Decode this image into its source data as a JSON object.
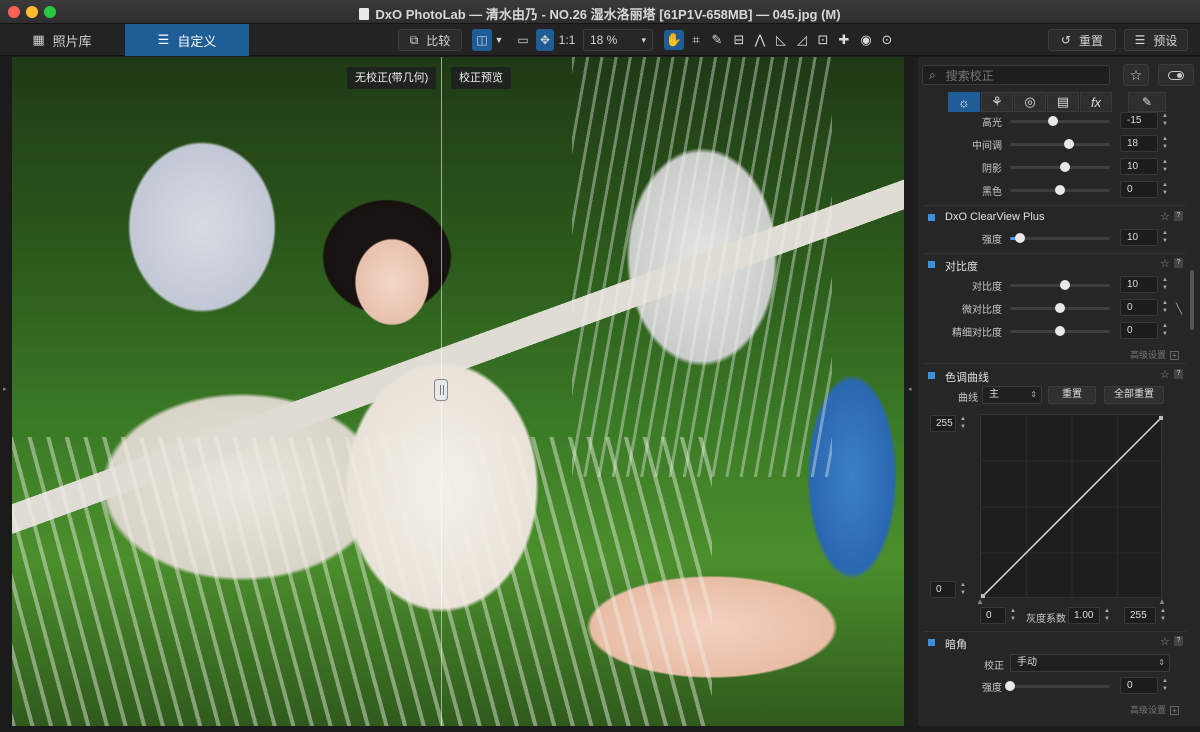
{
  "window": {
    "title": "DxO PhotoLab — 清水由乃 - NO.26 湿水洛丽塔 [61P1V-658MB] — 045.jpg (M)"
  },
  "toolbar": {
    "tab_library": "照片库",
    "tab_customize": "自定义",
    "compare_label": "比较",
    "ratio_label": "1:1",
    "zoom_value": "18 %",
    "reset_label": "重置",
    "preset_label": "预设"
  },
  "viewer": {
    "label_before": "无校正(带几何)",
    "label_after": "校正预览"
  },
  "panel": {
    "search_placeholder": "搜索校正",
    "tone": {
      "rows": [
        {
          "label": "高光",
          "value": "-15",
          "fraction": 0.43
        },
        {
          "label": "中间调",
          "value": "18",
          "fraction": 0.59
        },
        {
          "label": "阴影",
          "value": "10",
          "fraction": 0.55
        },
        {
          "label": "黑色",
          "value": "0",
          "fraction": 0.5
        }
      ]
    },
    "clearview": {
      "title": "DxO ClearView Plus",
      "strength_label": "强度",
      "strength_value": "10",
      "strength_fraction": 0.1
    },
    "contrast": {
      "title": "对比度",
      "rows": [
        {
          "label": "对比度",
          "value": "10",
          "fraction": 0.55
        },
        {
          "label": "微对比度",
          "value": "0",
          "fraction": 0.5
        },
        {
          "label": "精细对比度",
          "value": "0",
          "fraction": 0.5
        }
      ],
      "advanced_label": "高级设置"
    },
    "tone_curve": {
      "title": "色调曲线",
      "curve_label": "曲线",
      "channel_value": "主",
      "reset_label": "重置",
      "reset_all_label": "全部重置",
      "top_value": "255",
      "bottom_value": "0",
      "input_black": "0",
      "gamma_label": "灰度系数",
      "gamma_value": "1.00",
      "input_white": "255"
    },
    "vignetting": {
      "title": "暗角",
      "correction_label": "校正",
      "correction_value": "手动",
      "strength_label": "强度",
      "strength_value": "0",
      "strength_fraction": 0.0,
      "advanced_label": "高级设置"
    }
  },
  "colors": {
    "accent": "#1f5d96",
    "slider_fill": "#4a9be8",
    "section_marker": "#3b8fe0"
  }
}
